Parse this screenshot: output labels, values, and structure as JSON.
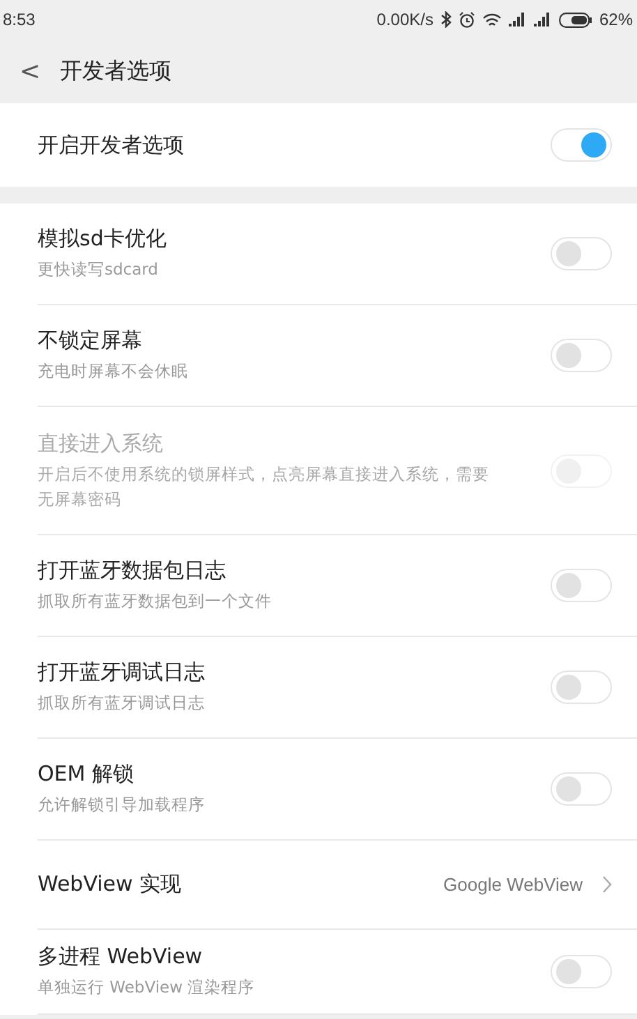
{
  "status_bar": {
    "time": "8:53",
    "speed": "0.00K/s",
    "battery": "62%"
  },
  "header": {
    "back": "<",
    "title": "开发者选项"
  },
  "master": {
    "label": "开启开发者选项",
    "on": true
  },
  "settings": [
    {
      "kind": "toggle",
      "title": "模拟sd卡优化",
      "subtitle": "更快读写sdcard",
      "on": false,
      "disabled": false
    },
    {
      "kind": "toggle",
      "title": "不锁定屏幕",
      "subtitle": "充电时屏幕不会休眠",
      "on": false,
      "disabled": false
    },
    {
      "kind": "toggle",
      "title": "直接进入系统",
      "subtitle": "开启后不使用系统的锁屏样式，点亮屏幕直接进入系统，需要无屏幕密码",
      "on": false,
      "disabled": true
    },
    {
      "kind": "toggle",
      "title": "打开蓝牙数据包日志",
      "subtitle": "抓取所有蓝牙数据包到一个文件",
      "on": false,
      "disabled": false
    },
    {
      "kind": "toggle",
      "title": "打开蓝牙调试日志",
      "subtitle": "抓取所有蓝牙调试日志",
      "on": false,
      "disabled": false
    },
    {
      "kind": "toggle",
      "title": "OEM 解锁",
      "subtitle": "允许解锁引导加载程序",
      "on": false,
      "disabled": false
    },
    {
      "kind": "value",
      "title": "WebView 实现",
      "value": "Google WebView"
    },
    {
      "kind": "toggle",
      "title": "多进程 WebView",
      "subtitle": "单独运行 WebView 渲染程序",
      "on": false,
      "disabled": false
    }
  ]
}
